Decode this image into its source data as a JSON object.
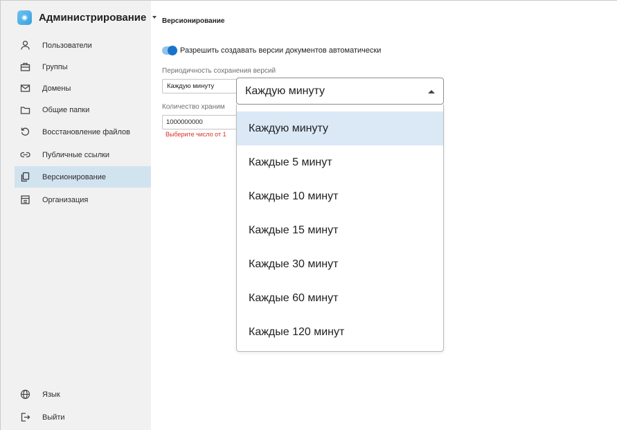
{
  "app": {
    "title": "Администрирование"
  },
  "sidebar": {
    "items": [
      {
        "label": "Пользователи",
        "icon": "user-icon"
      },
      {
        "label": "Группы",
        "icon": "briefcase-icon"
      },
      {
        "label": "Домены",
        "icon": "mail-icon"
      },
      {
        "label": "Общие папки",
        "icon": "folder-icon"
      },
      {
        "label": "Восстановление файлов",
        "icon": "restore-icon"
      },
      {
        "label": "Публичные ссылки",
        "icon": "link-icon"
      },
      {
        "label": "Версионирование",
        "icon": "copy-icon",
        "active": true
      },
      {
        "label": "Организация",
        "icon": "building-icon"
      }
    ],
    "bottom": [
      {
        "label": "Язык",
        "icon": "globe-icon"
      },
      {
        "label": "Выйти",
        "icon": "logout-icon"
      }
    ]
  },
  "main": {
    "section_title": "Версионирование",
    "auto_versions": {
      "label": "Разрешить создавать версии документов автоматически",
      "enabled": true
    },
    "period": {
      "label": "Периодичность сохранения версий",
      "value": "Каждую минуту"
    },
    "count": {
      "label": "Количество храним",
      "value": "1000000000",
      "error": "Выберите число от 1"
    }
  },
  "dropdown": {
    "value": "Каждую минуту",
    "options": [
      "Каждую минуту",
      "Каждые 5 минут",
      "Каждые 10 минут",
      "Каждые 15 минут",
      "Каждые 30 минут",
      "Каждые 60 минут",
      "Каждые 120 минут"
    ],
    "selected_index": 0
  },
  "colors": {
    "accent": "#1a73c9",
    "active_bg": "#d2e3f0",
    "error": "#d93025",
    "option_highlight": "#dbe9f6"
  }
}
